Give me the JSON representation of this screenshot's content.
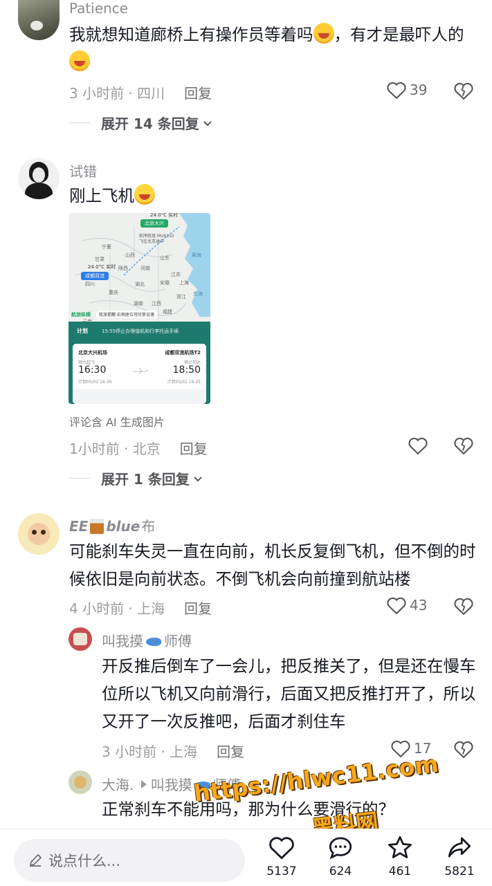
{
  "comments": [
    {
      "user": "Patience",
      "text_before": "我就想知道廊桥上有操作员等着吗",
      "text_after": "，有才是最吓人的",
      "time_loc": "3 小时前 · 四川",
      "reply_label": "回复",
      "likes": "39",
      "expand_label": "展开 14 条回复"
    },
    {
      "user": "试错",
      "text": "刚上飞机",
      "ai_note": "评论含 AI 生成图片",
      "time_loc": "1小时前 · 北京",
      "reply_label": "回复",
      "likes": "",
      "expand_label": "展开 1 条回复"
    },
    {
      "user_prefix": "EE",
      "user_suffix": "blue",
      "user_tail": "布",
      "text": "可能刹车失灵一直在向前，机长反复倒飞机，但不倒的时候依旧是向前状态。不倒飞机会向前撞到航站楼",
      "time_loc": "4 小时前 · 上海",
      "reply_label": "回复",
      "likes": "43"
    }
  ],
  "replies": [
    {
      "user_a": "叫我摸",
      "user_b": "师傅",
      "text": "开反推后倒车了一会儿，把反推关了，但是还在慢车位所以飞机又向前滑行，后面又把反推打开了，所以又开了一次反推吧，后面才刹住车",
      "time_loc": "3 小时前 · 上海",
      "reply_label": "回复",
      "likes": "17"
    },
    {
      "user": "大海.",
      "reply_to_a": "叫我摸",
      "reply_to_b": "师傅",
      "text": "正常刹车不能用吗，那为什么要滑行的？"
    }
  ],
  "map_card": {
    "temp_top": "24.0°C 实时",
    "dest_tag": "北京大兴",
    "flight_line": "前序航班 MU6110",
    "flight_sub": "飞往北京途中",
    "temp_origin": "24.0°C 实时",
    "origin_tag": "成都双流",
    "provinces": [
      "宁夏",
      "甘肃",
      "山西",
      "河南",
      "山东",
      "陕西",
      "江苏",
      "安徽",
      "上海",
      "湖北",
      "四川",
      "重庆",
      "浙江",
      "湖南",
      "江西",
      "东海",
      "黄海",
      "福建",
      "云南"
    ],
    "brand": "航旅纵横",
    "notice": "航旅提醒:右侧座位可欣赏日落",
    "plan_label": "计划",
    "plan_text": "15:55停止办理值机和行李托运手续",
    "dep_airport": "北京大兴机场",
    "arr_airport": "成都双流机场T2",
    "dep_sub": "预计起飞",
    "arr_sub": "预计到达",
    "dep_time": "16:30",
    "arr_time": "18:50",
    "dep_plan": "计划05/02 16:30",
    "arr_plan": "计划05/02 19:25"
  },
  "bottom_bar": {
    "placeholder": "说点什么...",
    "like_count": "5137",
    "comment_count": "624",
    "star_count": "461",
    "share_count": "5821"
  },
  "watermark": {
    "line1": "https://hlwc11.com",
    "line2": "黑料网"
  },
  "colors": {
    "text": "#161823",
    "meta": "#9a9ba1",
    "watermark": "#f6a81c"
  },
  "icons": [
    "heart-icon",
    "dislike-heart-icon",
    "chevron-down-icon",
    "pencil-icon",
    "comment-icon",
    "star-icon",
    "share-icon",
    "fish-emoji-icon",
    "whiskey-emoji-icon",
    "laugh-cry-emoji-icon",
    "dizzy-emoji-icon",
    "play-arrow-icon"
  ]
}
